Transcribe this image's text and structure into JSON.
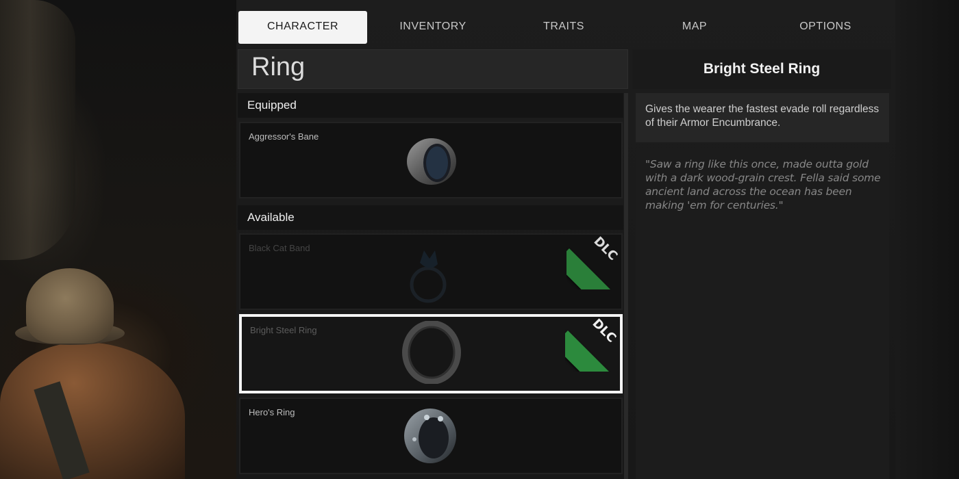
{
  "tabs": [
    {
      "label": "CHARACTER",
      "active": true
    },
    {
      "label": "INVENTORY",
      "active": false
    },
    {
      "label": "TRAITS",
      "active": false
    },
    {
      "label": "MAP",
      "active": false
    },
    {
      "label": "OPTIONS",
      "active": false
    }
  ],
  "category": {
    "title": "Ring"
  },
  "equipped": {
    "heading": "Equipped",
    "items": [
      {
        "name": "Aggressor's Bane",
        "icon": "steel-ring-icon"
      }
    ]
  },
  "available": {
    "heading": "Available",
    "items": [
      {
        "name": "Black Cat Band",
        "icon": "cat-ring-icon",
        "badge": "DLC",
        "locked": true
      },
      {
        "name": "Bright Steel Ring",
        "icon": "plain-ring-icon",
        "badge": "DLC",
        "selected": true
      },
      {
        "name": "Hero's Ring",
        "icon": "studded-ring-icon"
      }
    ]
  },
  "detail": {
    "title": "Bright Steel Ring",
    "description": "Gives the wearer the fastest evade roll regardless of their Armor Encumbrance.",
    "lore": "\"Saw a ring like this once, made outta gold with a dark wood-grain crest. Fella said some ancient land across the ocean has been making 'em for centuries.\""
  },
  "colors": {
    "dlc_badge": "#2c8a3d",
    "selected_border": "#f5f5f5",
    "active_tab": "#f4f4f4"
  }
}
